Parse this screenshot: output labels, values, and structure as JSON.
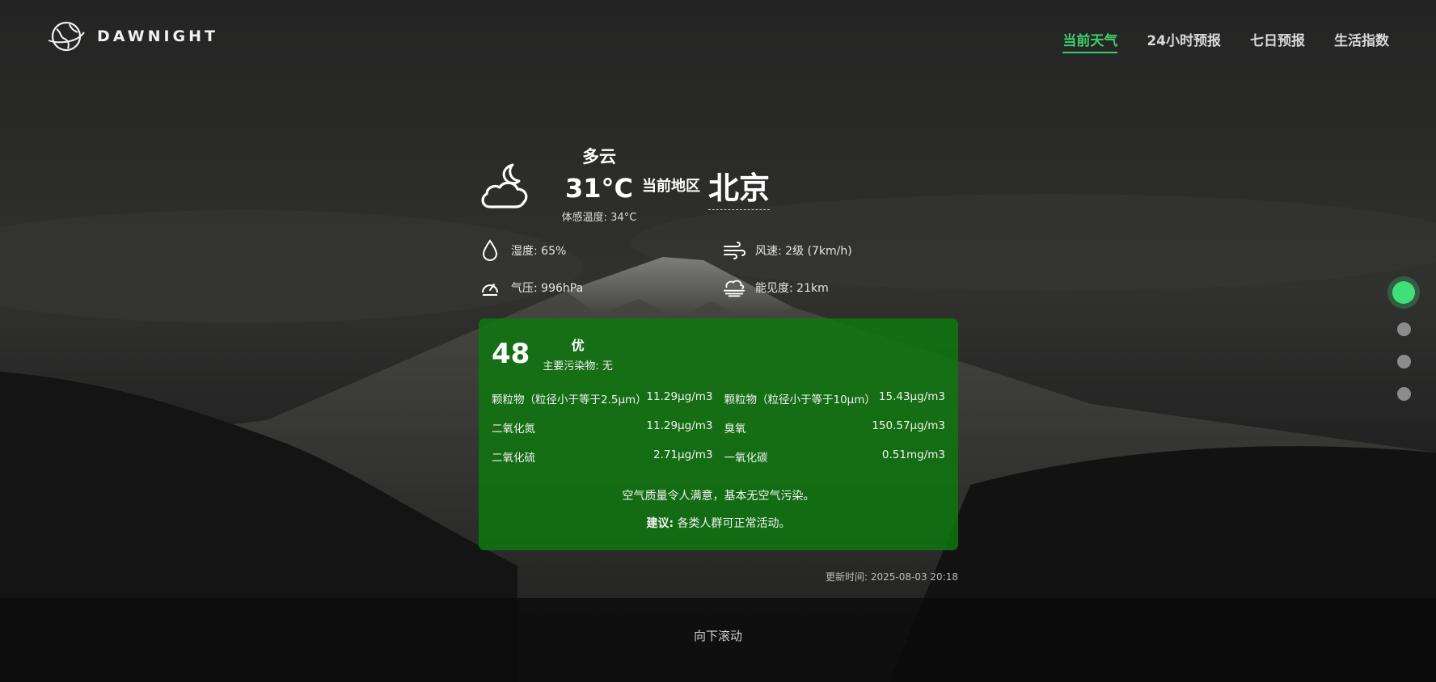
{
  "header": {
    "logo_text": "DAWNIGHT",
    "nav": [
      {
        "label": "当前天气",
        "active": true
      },
      {
        "label": "24小时预报",
        "active": false
      },
      {
        "label": "七日预报",
        "active": false
      },
      {
        "label": "生活指数",
        "active": false
      }
    ]
  },
  "current": {
    "icon": "cloudy-night-icon",
    "condition": "多云",
    "temperature": "31°C",
    "feels_like": "体感温度: 34°C",
    "region_label": "当前地区",
    "city": "北京"
  },
  "metrics": [
    {
      "icon": "humidity-icon",
      "text": "湿度: 65%"
    },
    {
      "icon": "wind-icon",
      "text": "风速: 2级 (7km/h)"
    },
    {
      "icon": "pressure-icon",
      "text": "气压: 996hPa"
    },
    {
      "icon": "visibility-icon",
      "text": "能见度: 21km"
    }
  ],
  "air_quality": {
    "aqi": "48",
    "grade": "优",
    "primary_pollutant": "主要污染物: 无",
    "pollutants": [
      {
        "name": "颗粒物（粒径小于等于2.5μm）",
        "value": "11.29μg/m3"
      },
      {
        "name": "颗粒物（粒径小于等于10μm）",
        "value": "15.43μg/m3"
      },
      {
        "name": "二氧化氮",
        "value": "11.29μg/m3"
      },
      {
        "name": "臭氧",
        "value": "150.57μg/m3"
      },
      {
        "name": "二氧化硫",
        "value": "2.71μg/m3"
      },
      {
        "name": "一氧化碳",
        "value": "0.51mg/m3"
      }
    ],
    "description": "空气质量令人满意，基本无空气污染。",
    "suggestion_label": "建议:",
    "suggestion": " 各类人群可正常活动。",
    "background_color": "#0e7a0e"
  },
  "updated": "更新时间: 2025-08-03 20:18",
  "scroll_hint": "向下滚动",
  "colors": {
    "accent": "#3ccf68",
    "dot_active": "#3ee07a",
    "dot_inactive": "#8c8c8c"
  }
}
